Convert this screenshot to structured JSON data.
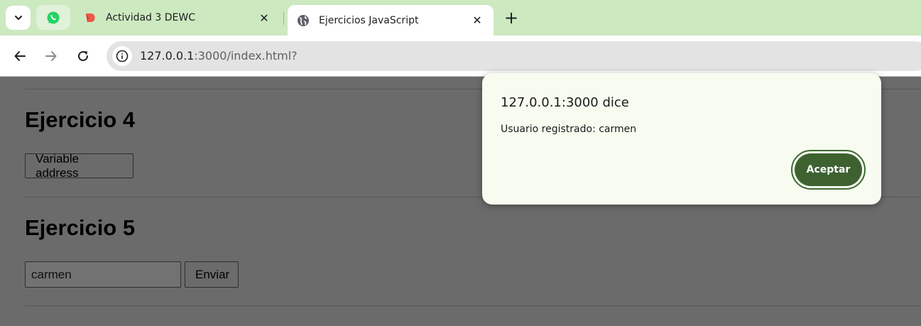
{
  "browser": {
    "tabs": [
      {
        "title": "Actividad 3 DEWC",
        "active": false
      },
      {
        "title": "Ejercicios JavaScript",
        "active": true
      }
    ],
    "close_glyph": "✕",
    "new_tab_glyph": "+",
    "url_host": "127.0.0.1",
    "url_rest": ":3000/index.html?",
    "tab_strip_color": "#cce9c0"
  },
  "page": {
    "sections": [
      {
        "heading": "Ejercicio 4",
        "button_label": "Variable address"
      },
      {
        "heading": "Ejercicio 5",
        "input_value": "carmen",
        "button_label": "Enviar"
      }
    ]
  },
  "dialog": {
    "title": "127.0.0.1:3000 dice",
    "message": "Usuario registrado: carmen",
    "ok_label": "Aceptar",
    "accent_color": "#3d6230"
  }
}
